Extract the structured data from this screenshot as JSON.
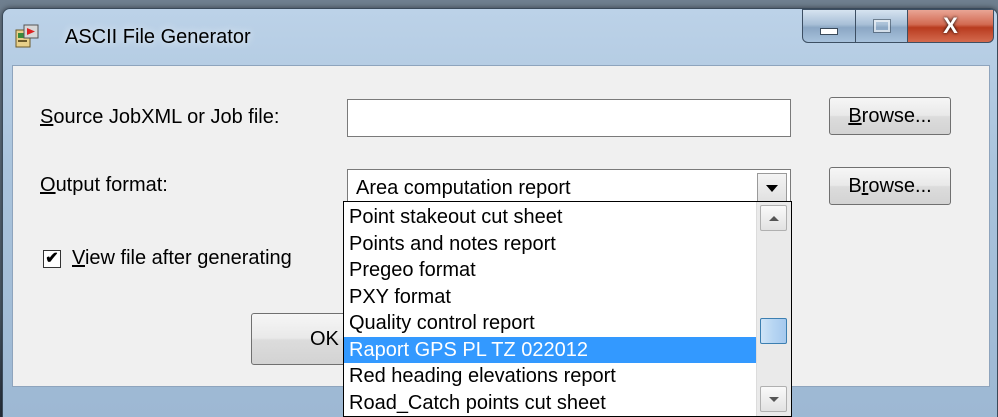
{
  "window": {
    "title": "ASCII File Generator",
    "icon": "app-icon",
    "close_glyph": "X"
  },
  "form": {
    "source_label_mnemonic": "S",
    "source_label_rest": "ource JobXML or Job file:",
    "source_value": "",
    "browse1_mnemonic": "B",
    "browse1_rest": "rowse...",
    "output_label_mnemonic": "O",
    "output_label_rest": "utput format:",
    "output_value": "Area computation report",
    "browse2_pre": "B",
    "browse2_mnemonic": "r",
    "browse2_rest": "owse...",
    "checkbox_checked_glyph": "✔",
    "view_label_mnemonic": "V",
    "view_label_rest": "iew file after generating",
    "ok_label": "OK"
  },
  "dropdown": {
    "items": [
      "Point stakeout cut sheet",
      "Points and notes report",
      "Pregeo format",
      "PXY format",
      "Quality control report",
      "Raport GPS PL TZ 022012",
      "Red heading elevations report",
      "Road_Catch points cut sheet"
    ],
    "selected_index": 5
  },
  "colors": {
    "selection": "#3399ff",
    "close_button": "#c9442a"
  }
}
